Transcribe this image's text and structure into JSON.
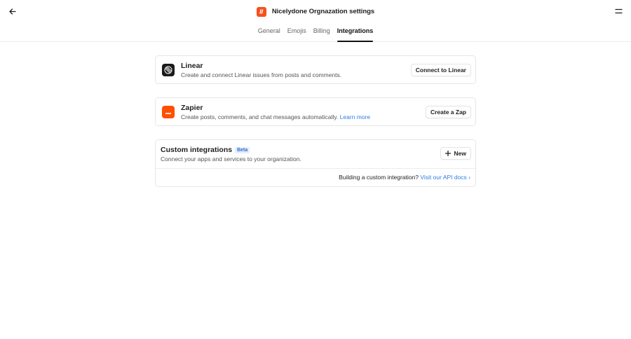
{
  "header": {
    "title": "Nicelydone Orgnazation settings",
    "back_icon": "arrow-left-icon",
    "menu_icon": "menu-icon",
    "org_logo_color": "#f4511e"
  },
  "tabs": [
    {
      "label": "General",
      "active": false
    },
    {
      "label": "Emojis",
      "active": false
    },
    {
      "label": "Billing",
      "active": false
    },
    {
      "label": "Integrations",
      "active": true
    }
  ],
  "integrations": {
    "linear": {
      "name": "Linear",
      "description": "Create and connect Linear issues from posts and comments.",
      "button": "Connect to Linear",
      "icon": "linear-logo-icon",
      "icon_color": "#1b1b1b"
    },
    "zapier": {
      "name": "Zapier",
      "description": "Create posts, comments, and chat messages automatically.",
      "link": "Learn more",
      "button": "Create a Zap",
      "icon": "zapier-logo-icon",
      "icon_color": "#ff4f00"
    },
    "custom": {
      "title": "Custom integrations",
      "badge": "Beta",
      "description": "Connect your apps and services to your organization.",
      "button": "New",
      "button_icon": "plus-icon",
      "footer_text": "Building a custom integration?",
      "footer_link": "Visit our API docs ›"
    }
  },
  "colors": {
    "accent_link": "#2f7de1",
    "badge_bg": "#e6efff"
  }
}
